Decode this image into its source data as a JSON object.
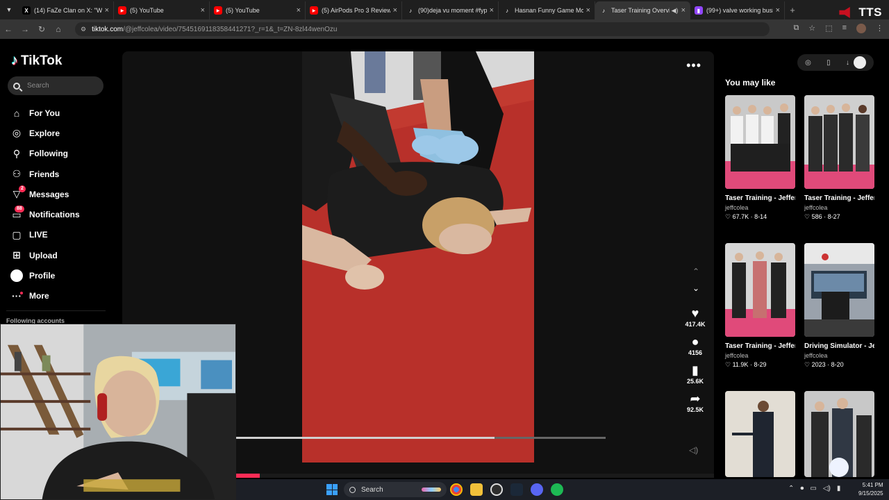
{
  "browser": {
    "tabs": [
      {
        "title": "(14) FaZe Clan on X: \"We",
        "favicon": "X",
        "favicon_color": "#ffffff",
        "favicon_bg": "#000000"
      },
      {
        "title": "(5) YouTube",
        "favicon": "▶",
        "favicon_color": "#ffffff",
        "favicon_bg": "#ff0000"
      },
      {
        "title": "(5) YouTube",
        "favicon": "▶",
        "favicon_color": "#ffffff",
        "favicon_bg": "#ff0000"
      },
      {
        "title": "(5) AirPods Pro 3 Review:",
        "favicon": "▶",
        "favicon_color": "#ffffff",
        "favicon_bg": "#ff0000"
      },
      {
        "title": "(90)deja vu moment #fyp",
        "favicon": "♪",
        "favicon_color": "#ffffff",
        "favicon_bg": "#000000"
      },
      {
        "title": "Hasnan Funny Game Mo",
        "favicon": "♪",
        "favicon_color": "#ffffff",
        "favicon_bg": "#000000"
      },
      {
        "title": "Taser Training Overvi",
        "favicon": "♪",
        "favicon_color": "#ffffff",
        "favicon_bg": "#000000",
        "active": true
      },
      {
        "title": "(99+) valve working busi",
        "favicon": "▮",
        "favicon_color": "#ffffff",
        "favicon_bg": "#9146ff"
      }
    ],
    "overlay_label": "TTS",
    "url_host": "tiktok.com",
    "url_path": "/@jeffcolea/video/7545169118358441271?_r=1&_t=ZN-8zl44wenOzu"
  },
  "sidebar": {
    "logo": "TikTok",
    "search_placeholder": "Search",
    "items": [
      {
        "label": "For You",
        "icon": "home-icon"
      },
      {
        "label": "Explore",
        "icon": "compass-icon"
      },
      {
        "label": "Following",
        "icon": "following-icon"
      },
      {
        "label": "Friends",
        "icon": "friends-icon"
      },
      {
        "label": "Messages",
        "icon": "messages-icon",
        "badge": "2"
      },
      {
        "label": "Notifications",
        "icon": "inbox-icon",
        "badge": "88"
      },
      {
        "label": "LIVE",
        "icon": "live-icon"
      },
      {
        "label": "Upload",
        "icon": "upload-icon"
      },
      {
        "label": "Profile",
        "icon": "profile-icon"
      },
      {
        "label": "More",
        "icon": "more-icon"
      }
    ],
    "following_accounts": "Following accounts"
  },
  "video": {
    "actions": {
      "likes": "417.4K",
      "comments": "4156",
      "saves": "25.6K",
      "shares": "92.5K"
    },
    "seek_fraction": 0.7,
    "playback_fraction": 0.05
  },
  "rail": {
    "title": "You may like",
    "cards": [
      {
        "title": "Taser Training - Jefferson College...",
        "author": "jeffcolea",
        "likes": "67.7K",
        "date": "8-14"
      },
      {
        "title": "Taser Training - Jefferson College...",
        "author": "jeffcolea",
        "likes": "586",
        "date": "8-27"
      },
      {
        "title": "Taser Training - Jefferson College...",
        "author": "jeffcolea",
        "likes": "11.9K",
        "date": "8-29"
      },
      {
        "title": "Driving Simulator - Jefferson College...",
        "author": "jeffcolea",
        "likes": "2023",
        "date": "8-20"
      },
      {
        "title": "",
        "author": "",
        "likes": "",
        "date": ""
      },
      {
        "title": "",
        "author": "",
        "likes": "",
        "date": ""
      }
    ]
  },
  "taskbar": {
    "search_label": "Search",
    "time": "5:41 PM",
    "date": "9/15/2025"
  },
  "colors": {
    "accent": "#fe2c55",
    "mat": "#b8302a"
  }
}
